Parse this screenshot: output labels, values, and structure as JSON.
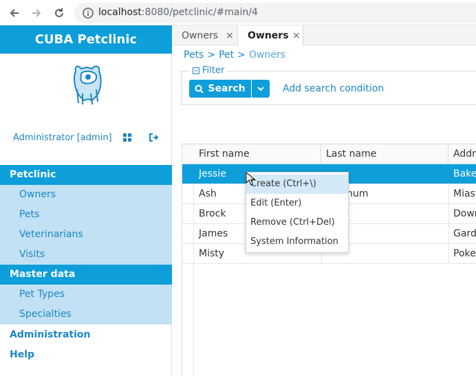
{
  "browser": {
    "url_host": "localhost",
    "url_rest": ":8080/petclinic/#main/4"
  },
  "sidebar": {
    "app_title": "CUBA Petclinic",
    "user_name": "Administrator [admin]",
    "groups": [
      {
        "label": "Petclinic",
        "items": [
          "Owners",
          "Pets",
          "Veterinarians",
          "Visits"
        ]
      },
      {
        "label": "Master data",
        "items": [
          "Pet Types",
          "Specialties"
        ]
      }
    ],
    "top_items": [
      "Administration",
      "Help"
    ]
  },
  "tabs": [
    {
      "label": "Owners",
      "active": false
    },
    {
      "label": "Owners",
      "active": true
    }
  ],
  "breadcrumb": [
    "Pets",
    "Pet",
    "Owners"
  ],
  "filter": {
    "legend": "Filter",
    "search_label": "Search",
    "add_condition_label": "Add search condition"
  },
  "table": {
    "columns": [
      "First name",
      "Last name",
      "Address"
    ],
    "rows": [
      {
        "first": "Jessie",
        "last": "",
        "addr": "Baker"
      },
      {
        "first": "Ash",
        "last": "num",
        "addr": "Miast"
      },
      {
        "first": "Brock",
        "last": "",
        "addr": "Down"
      },
      {
        "first": "James",
        "last": "",
        "addr": "Garde"
      },
      {
        "first": "Misty",
        "last": "",
        "addr": "Poker"
      }
    ]
  },
  "context_menu": {
    "items": [
      "Create (Ctrl+\\)",
      "Edit (Enter)",
      "Remove (Ctrl+Del)",
      "System Information"
    ]
  },
  "colors": {
    "accent": "#0e9ed9",
    "link": "#1b86c4",
    "submenu_bg": "#c2e1f4"
  }
}
